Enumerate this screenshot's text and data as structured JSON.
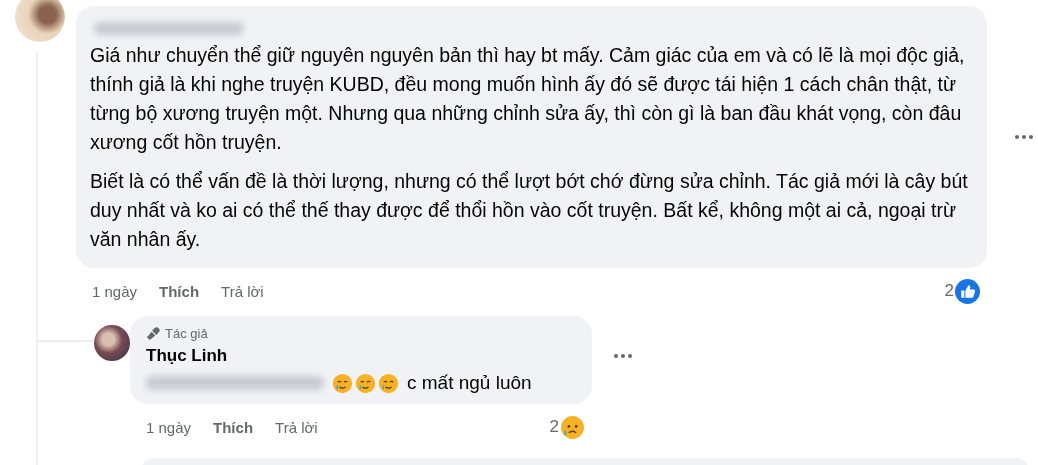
{
  "comment": {
    "paragraphs": [
      "Giá như chuyển thể giữ nguyên nguyên bản thì hay bt mấy. Cảm giác của em và có lẽ là mọi độc giả, thính giả là khi nghe truyện KUBD, đều mong muốn hình ấy đó sẽ được tái hiện 1 cách chân thật, từ từng bộ xương truyện một. Nhưng qua những chỉnh sửa ấy, thì còn gì là ban đầu khát vọng, còn đâu xương cốt hồn truyện.",
      "Biết là có thể vấn đề là thời lượng, nhưng có thể lượt bớt chớ đừng sửa chỉnh. Tác giả mới là cây bút duy nhất và ko ai có thể thế thay được để thổi hồn vào cốt truyện. Bất kể, không một ai cả, ngoại trừ văn nhân ấy."
    ],
    "time": "1 ngày",
    "like": "Thích",
    "reply": "Trả lời",
    "reaction_count": "2",
    "reaction": {
      "kind": "like"
    }
  },
  "reply": {
    "badge": "Tác giả",
    "author": "Thục Linh",
    "emojis": [
      {
        "kind": "teary-smile"
      },
      {
        "kind": "teary-smile"
      },
      {
        "kind": "teary-smile"
      }
    ],
    "text": "c mất ngủ luôn",
    "time": "1 ngày",
    "like": "Thích",
    "reply": "Trả lời",
    "reaction_count": "2",
    "reaction": {
      "kind": "sad"
    }
  }
}
